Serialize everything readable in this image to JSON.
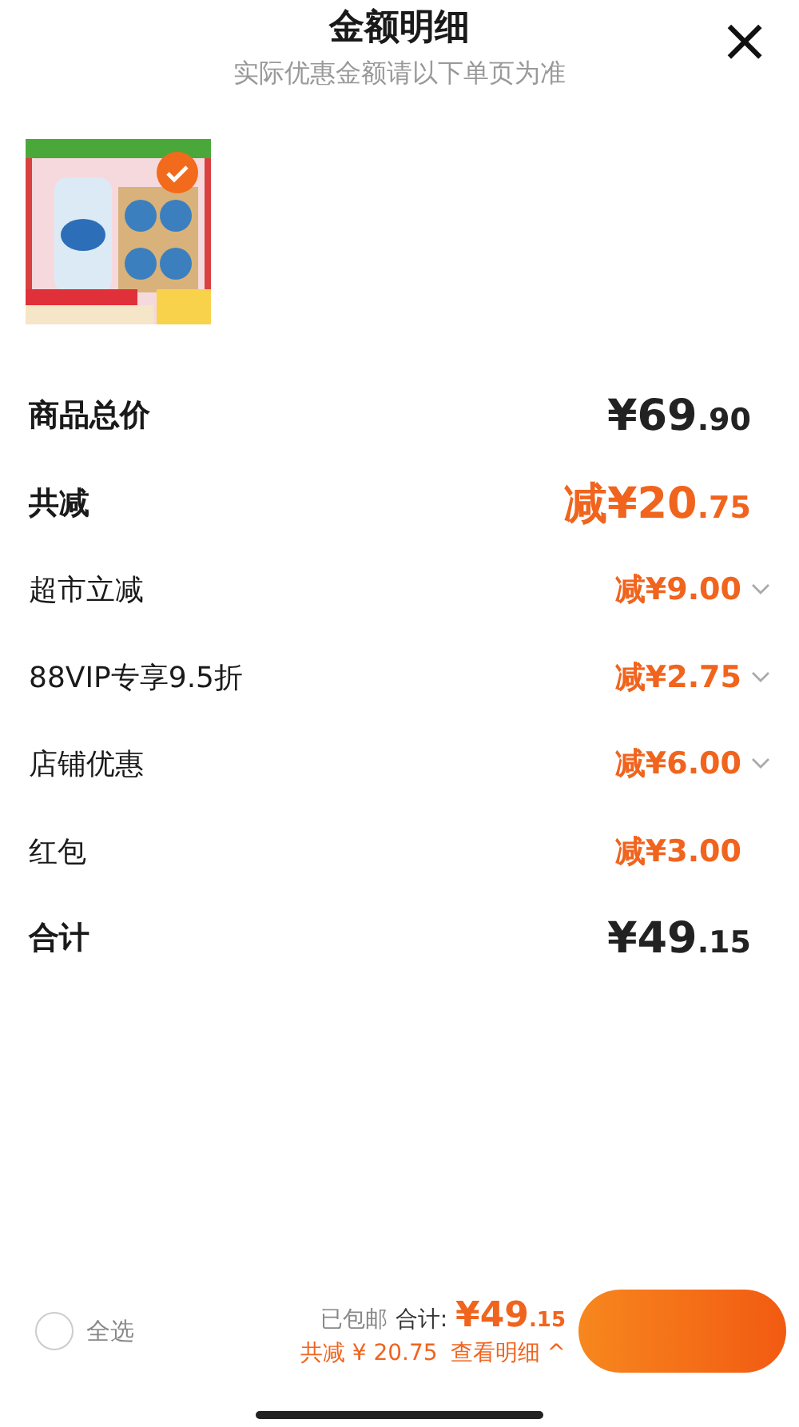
{
  "header": {
    "title": "金额明细",
    "subtitle": "实际优惠金额请以下单页为准",
    "close": "×"
  },
  "product": {
    "kind": "picture",
    "selected": true
  },
  "rows": [
    {
      "kind": "total",
      "label": "商品总价",
      "amount": "¥69",
      "cents": ".90"
    },
    {
      "kind": "discount",
      "label": "共减",
      "amount": "减¥20",
      "cents": ".75"
    },
    {
      "kind": "item",
      "label": "超市立减",
      "amount": "减¥9.00",
      "expandable": true
    },
    {
      "kind": "item",
      "label": "88VIP专享9.5折",
      "amount": "减¥2.75",
      "expandable": true
    },
    {
      "kind": "item",
      "label": "店铺优惠",
      "amount": "减¥6.00",
      "expandable": true
    },
    {
      "kind": "item",
      "label": "红包",
      "amount": "减¥3.00",
      "expandable": false
    },
    {
      "kind": "total",
      "label": "合计",
      "amount": "¥49",
      "cents": ".15"
    }
  ],
  "footer": {
    "select_all": {
      "label": "全选",
      "checked": false
    },
    "shipping": "已包邮",
    "total_label": "合计:",
    "total_amount": "¥49",
    "total_cents": ".15",
    "saved": "共减 ¥ 20.75",
    "details_link": "查看明细 ^"
  }
}
